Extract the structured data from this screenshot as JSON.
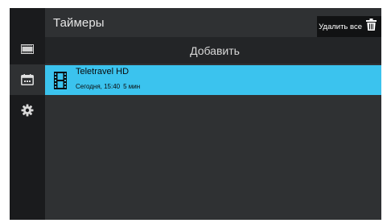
{
  "header": {
    "title": "Таймеры",
    "delete_all_label": "Удалить все"
  },
  "add": {
    "label": "Добавить"
  },
  "sidebar": {
    "items": [
      {
        "icon": "filmstrip-icon",
        "active": false
      },
      {
        "icon": "calendar-icon",
        "active": true
      },
      {
        "icon": "gear-icon",
        "active": false
      }
    ]
  },
  "timers": [
    {
      "icon": "film-icon",
      "channel": "Teletravel HD",
      "date_time": "Сегодня, 15:40",
      "duration": "5 мин",
      "selected": true
    }
  ],
  "colors": {
    "accent": "#3bc3ee",
    "background": "#2f3133",
    "sidebar": "#1a1b1d"
  }
}
